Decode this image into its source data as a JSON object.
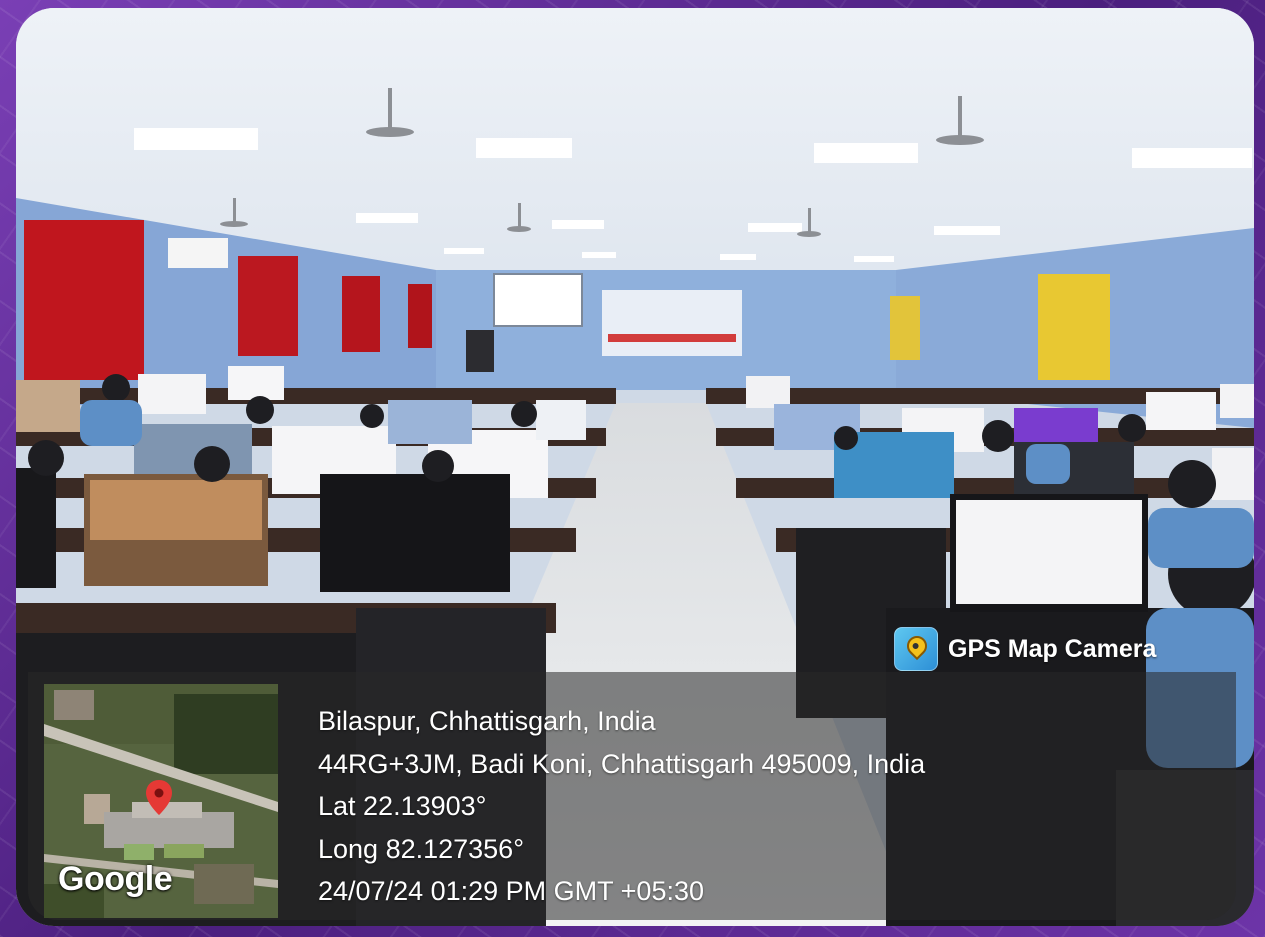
{
  "badge": {
    "app_name": "GPS Map Camera",
    "icon": "gps-map-camera-app-icon"
  },
  "location": {
    "place": "Bilaspur, Chhattisgarh, India",
    "address": "44RG+3JM, Badi Koni, Chhattisgarh 495009, India",
    "latitude": "Lat 22.13903°",
    "longitude": "Long 82.127356°",
    "timestamp": "24/07/24 01:29 PM GMT +05:30"
  },
  "map": {
    "provider_logo": "Google",
    "marker_icon": "map-pin-icon",
    "marker_color": "#e53935"
  },
  "colors": {
    "frame_purple": "#5b2a8c",
    "wall_blue": "#8fb0dc",
    "curtain_red": "#c0161e",
    "curtain_yellow": "#e8c832"
  }
}
